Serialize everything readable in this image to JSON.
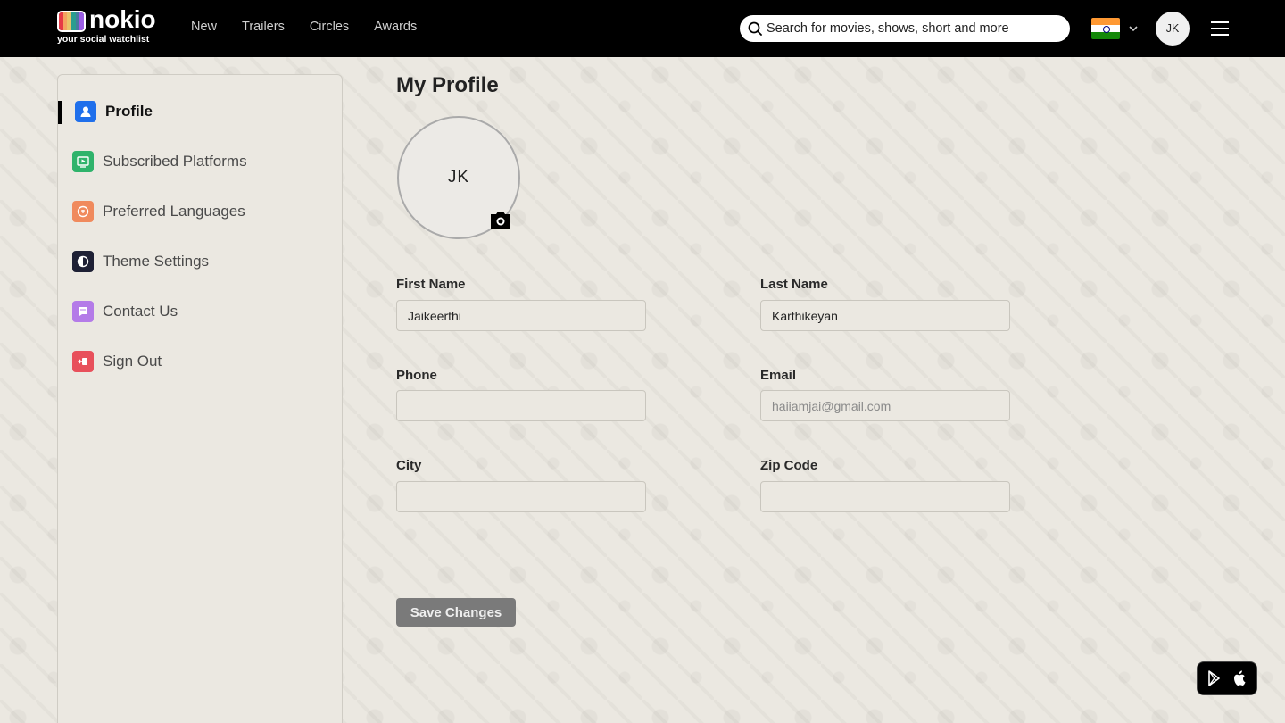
{
  "brand": {
    "name": "nokio",
    "tagline": "your social watchlist",
    "tv_colors": [
      "#e63946",
      "#f4a261",
      "#e9c46a",
      "#2a9d8f",
      "#457b9d",
      "#9b5de5"
    ]
  },
  "nav": {
    "items": [
      {
        "label": "New"
      },
      {
        "label": "Trailers"
      },
      {
        "label": "Circles"
      },
      {
        "label": "Awards"
      }
    ]
  },
  "search": {
    "placeholder": "Search for movies, shows, short and more",
    "icon": "search-icon"
  },
  "header": {
    "country_flag": "india-flag",
    "user_initials": "JK"
  },
  "sidebar": {
    "items": [
      {
        "label": "Profile",
        "icon": "profile-icon",
        "color": "#1f6feb",
        "active": true
      },
      {
        "label": "Subscribed Platforms",
        "icon": "play-screen-icon",
        "color": "#2fb36b"
      },
      {
        "label": "Preferred Languages",
        "icon": "language-chat-icon",
        "color": "#f08a5d"
      },
      {
        "label": "Theme Settings",
        "icon": "theme-contrast-icon",
        "color": "#1e2035"
      },
      {
        "label": "Contact Us",
        "icon": "message-icon",
        "color": "#b47be8"
      },
      {
        "label": "Sign Out",
        "icon": "sign-out-icon",
        "color": "#e8505b"
      }
    ]
  },
  "main": {
    "title": "My Profile",
    "avatar_initials": "JK",
    "form": {
      "first_name": {
        "label": "First Name",
        "value": "Jaikeerthi",
        "placeholder": ""
      },
      "last_name": {
        "label": "Last Name",
        "value": "Karthikeyan",
        "placeholder": ""
      },
      "phone": {
        "label": "Phone",
        "value": "",
        "placeholder": ""
      },
      "email": {
        "label": "Email",
        "value": "",
        "placeholder": "haiiamjai@gmail.com"
      },
      "city": {
        "label": "City",
        "value": "",
        "placeholder": ""
      },
      "zip": {
        "label": "Zip Code",
        "value": "",
        "placeholder": ""
      }
    },
    "save_label": "Save Changes"
  },
  "app_badges": [
    "google-play-icon",
    "apple-icon"
  ]
}
